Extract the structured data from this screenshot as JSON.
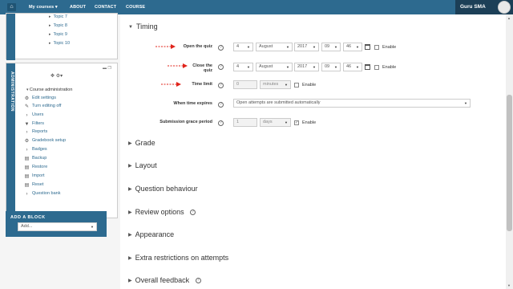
{
  "nav": {
    "items": [
      "My courses ▾",
      "ABOUT",
      "CONTACT",
      "COURSE"
    ],
    "user_name": "Guru SMA"
  },
  "sidebar": {
    "topics": [
      "Topic 7",
      "Topic 8",
      "Topic 9",
      "Topic 10"
    ],
    "admin_title": "ADMINISTRATION",
    "course_admin": "Course administration",
    "admin_items": [
      "Edit settings",
      "Turn editing off",
      "Users",
      "Filters",
      "Reports",
      "Gradebook setup",
      "Badges",
      "Backup",
      "Restore",
      "Import",
      "Reset",
      "Question bank"
    ],
    "add_block_title": "ADD A BLOCK",
    "add_block_placeholder": "Add..."
  },
  "timing": {
    "title": "Timing",
    "open_label": "Open the quiz",
    "close_label": "Close the quiz",
    "limit_label": "Time limit",
    "expires_label": "When time expires",
    "grace_label": "Submission grace period",
    "open": {
      "day": "4",
      "month": "August",
      "year": "2017",
      "hour": "09",
      "minute": "46"
    },
    "close": {
      "day": "4",
      "month": "August",
      "year": "2017",
      "hour": "09",
      "minute": "46"
    },
    "limit_value": "0",
    "limit_unit": "minutes",
    "expires_value": "Open attempts are submitted automatically",
    "grace_value": "1",
    "grace_unit": "days",
    "enable_label": "Enable"
  },
  "sections": [
    "Grade",
    "Layout",
    "Question behaviour",
    "Review options",
    "Appearance",
    "Extra restrictions on attempts",
    "Overall feedback"
  ],
  "colors": {
    "brand": "#2d6a8f",
    "annotation_arrow": "#e0241b"
  }
}
